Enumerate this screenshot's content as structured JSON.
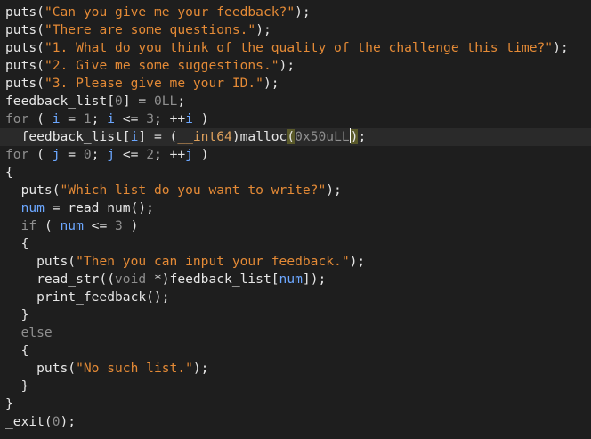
{
  "editor": {
    "lines": [
      [
        {
          "t": "puts",
          "c": "fn"
        },
        {
          "t": "(",
          "c": "op"
        },
        {
          "t": "\"Can you give me your feedback?\"",
          "c": "str"
        },
        {
          "t": ");",
          "c": "op"
        }
      ],
      [
        {
          "t": "puts",
          "c": "fn"
        },
        {
          "t": "(",
          "c": "op"
        },
        {
          "t": "\"There are some questions.\"",
          "c": "str"
        },
        {
          "t": ");",
          "c": "op"
        }
      ],
      [
        {
          "t": "puts",
          "c": "fn"
        },
        {
          "t": "(",
          "c": "op"
        },
        {
          "t": "\"1. What do you think of the quality of the challenge this time?\"",
          "c": "str"
        },
        {
          "t": ");",
          "c": "op"
        }
      ],
      [
        {
          "t": "puts",
          "c": "fn"
        },
        {
          "t": "(",
          "c": "op"
        },
        {
          "t": "\"2. Give me some suggestions.\"",
          "c": "str"
        },
        {
          "t": ");",
          "c": "op"
        }
      ],
      [
        {
          "t": "puts",
          "c": "fn"
        },
        {
          "t": "(",
          "c": "op"
        },
        {
          "t": "\"3. Please give me your ID.\"",
          "c": "str"
        },
        {
          "t": ");",
          "c": "op"
        }
      ],
      [
        {
          "t": "feedback_list",
          "c": "id"
        },
        {
          "t": "[",
          "c": "op"
        },
        {
          "t": "0",
          "c": "num"
        },
        {
          "t": "] = ",
          "c": "op"
        },
        {
          "t": "0LL",
          "c": "num"
        },
        {
          "t": ";",
          "c": "op"
        }
      ],
      [
        {
          "t": "for",
          "c": "kw"
        },
        {
          "t": " ( ",
          "c": "op"
        },
        {
          "t": "i",
          "c": "var"
        },
        {
          "t": " = ",
          "c": "op"
        },
        {
          "t": "1",
          "c": "num"
        },
        {
          "t": "; ",
          "c": "op"
        },
        {
          "t": "i",
          "c": "var"
        },
        {
          "t": " <= ",
          "c": "op"
        },
        {
          "t": "3",
          "c": "num"
        },
        {
          "t": "; ++",
          "c": "op"
        },
        {
          "t": "i",
          "c": "var"
        },
        {
          "t": " )",
          "c": "op"
        }
      ],
      [
        {
          "t": "  feedback_list",
          "c": "id"
        },
        {
          "t": "[",
          "c": "op"
        },
        {
          "t": "i",
          "c": "var"
        },
        {
          "t": "] = (",
          "c": "op"
        },
        {
          "t": "__int64",
          "c": "type"
        },
        {
          "t": ")malloc",
          "c": "op"
        },
        {
          "t": "(",
          "c": "paren"
        },
        {
          "t": "0x50uLL",
          "c": "num"
        },
        {
          "t": ")",
          "c": "paren"
        },
        {
          "t": ";",
          "c": "op"
        }
      ],
      [
        {
          "t": "for",
          "c": "kw"
        },
        {
          "t": " ( ",
          "c": "op"
        },
        {
          "t": "j",
          "c": "var"
        },
        {
          "t": " = ",
          "c": "op"
        },
        {
          "t": "0",
          "c": "num"
        },
        {
          "t": "; ",
          "c": "op"
        },
        {
          "t": "j",
          "c": "var"
        },
        {
          "t": " <= ",
          "c": "op"
        },
        {
          "t": "2",
          "c": "num"
        },
        {
          "t": "; ++",
          "c": "op"
        },
        {
          "t": "j",
          "c": "var"
        },
        {
          "t": " )",
          "c": "op"
        }
      ],
      [
        {
          "t": "{",
          "c": "op"
        }
      ],
      [
        {
          "t": "  puts",
          "c": "fn"
        },
        {
          "t": "(",
          "c": "op"
        },
        {
          "t": "\"Which list do you want to write?\"",
          "c": "str"
        },
        {
          "t": ");",
          "c": "op"
        }
      ],
      [
        {
          "t": "  ",
          "c": "op"
        },
        {
          "t": "num",
          "c": "var"
        },
        {
          "t": " = read_num();",
          "c": "op"
        }
      ],
      [
        {
          "t": "  ",
          "c": "op"
        },
        {
          "t": "if",
          "c": "kw"
        },
        {
          "t": " ( ",
          "c": "op"
        },
        {
          "t": "num",
          "c": "var"
        },
        {
          "t": " <= ",
          "c": "op"
        },
        {
          "t": "3",
          "c": "num"
        },
        {
          "t": " )",
          "c": "op"
        }
      ],
      [
        {
          "t": "  {",
          "c": "op"
        }
      ],
      [
        {
          "t": "    puts",
          "c": "fn"
        },
        {
          "t": "(",
          "c": "op"
        },
        {
          "t": "\"Then you can input your feedback.\"",
          "c": "str"
        },
        {
          "t": ");",
          "c": "op"
        }
      ],
      [
        {
          "t": "    read_str((",
          "c": "op"
        },
        {
          "t": "void",
          "c": "kw"
        },
        {
          "t": " *)feedback_list[",
          "c": "op"
        },
        {
          "t": "num",
          "c": "var"
        },
        {
          "t": "]);",
          "c": "op"
        }
      ],
      [
        {
          "t": "    print_feedback();",
          "c": "op"
        }
      ],
      [
        {
          "t": "  }",
          "c": "op"
        }
      ],
      [
        {
          "t": "  else",
          "c": "kw"
        }
      ],
      [
        {
          "t": "  {",
          "c": "op"
        }
      ],
      [
        {
          "t": "    puts",
          "c": "fn"
        },
        {
          "t": "(",
          "c": "op"
        },
        {
          "t": "\"No such list.\"",
          "c": "str"
        },
        {
          "t": ");",
          "c": "op"
        }
      ],
      [
        {
          "t": "  }",
          "c": "op"
        }
      ],
      [
        {
          "t": "}",
          "c": "op"
        }
      ],
      [
        {
          "t": "_exit(",
          "c": "op"
        },
        {
          "t": "0",
          "c": "num"
        },
        {
          "t": ");",
          "c": "op"
        }
      ]
    ],
    "current_line": 7,
    "colors": {
      "background": "#1e1e1e",
      "current_line": "#2a2a2a",
      "string": "#e48a36",
      "variable": "#6ca7ff",
      "keyword": "#8f8f8f",
      "type": "#dda05c",
      "paren_match": "#5a5a2a"
    }
  }
}
